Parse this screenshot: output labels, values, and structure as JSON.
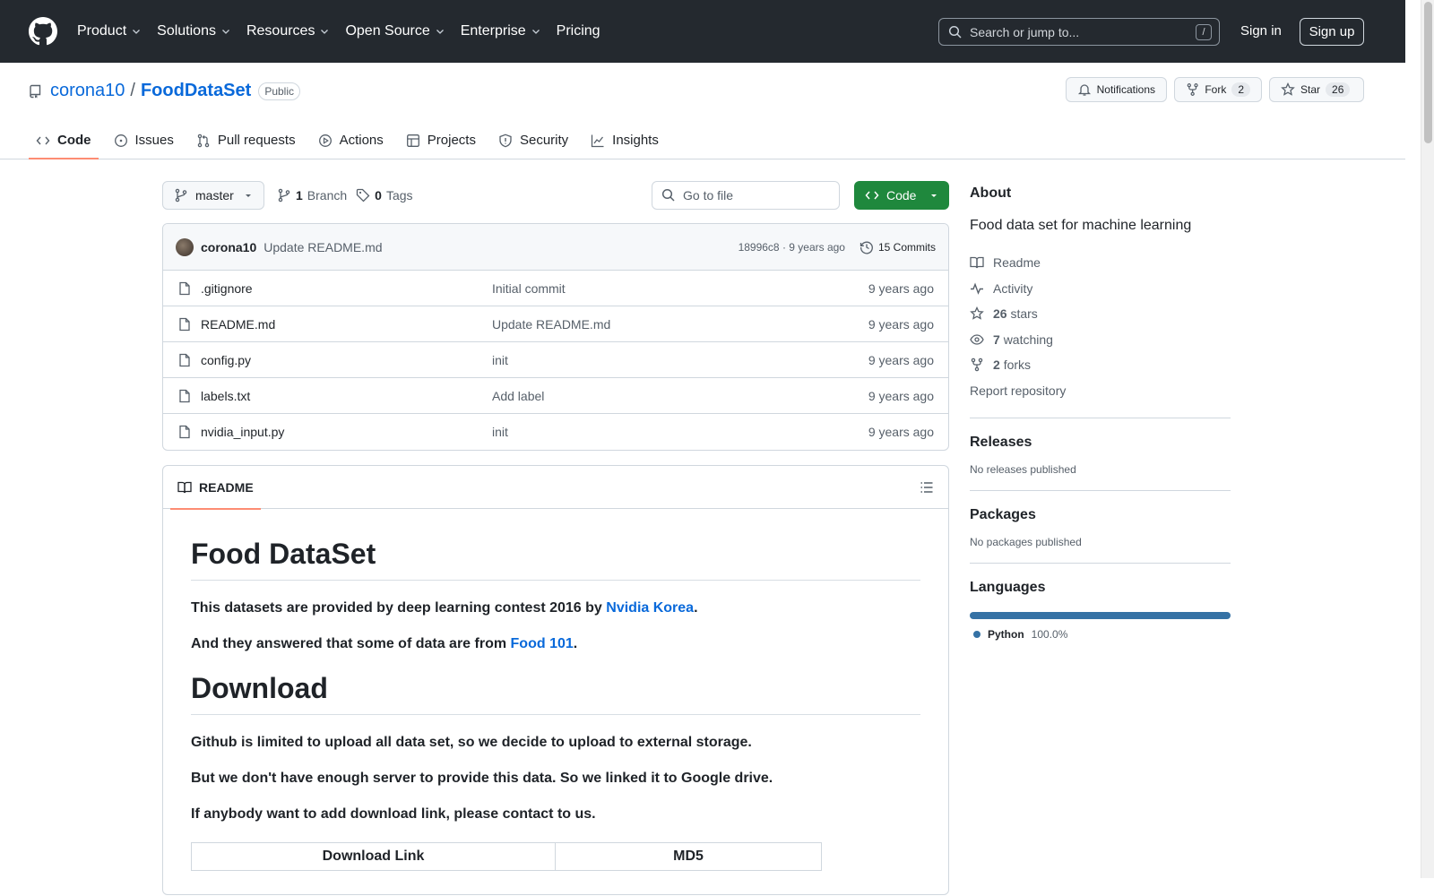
{
  "header": {
    "nav": [
      "Product",
      "Solutions",
      "Resources",
      "Open Source",
      "Enterprise",
      "Pricing"
    ],
    "search_placeholder": "Search or jump to...",
    "search_key": "/",
    "signin": "Sign in",
    "signup": "Sign up"
  },
  "repo": {
    "owner": "corona10",
    "separator": "/",
    "name": "FoodDataSet",
    "visibility": "Public",
    "notifications": "Notifications",
    "fork_label": "Fork",
    "fork_count": "2",
    "star_label": "Star",
    "star_count": "26"
  },
  "tabs": [
    "Code",
    "Issues",
    "Pull requests",
    "Actions",
    "Projects",
    "Security",
    "Insights"
  ],
  "filebar": {
    "branch": "master",
    "branch_count": "1",
    "branch_label": "Branch",
    "tag_count": "0",
    "tag_label": "Tags",
    "goto_placeholder": "Go to file",
    "code_button": "Code"
  },
  "last_commit": {
    "author": "corona10",
    "message": "Update README.md",
    "meta": "18996c8 · 9 years ago",
    "commits": "15 Commits"
  },
  "files": [
    {
      "name": ".gitignore",
      "message": "Initial commit",
      "age": "9 years ago"
    },
    {
      "name": "README.md",
      "message": "Update README.md",
      "age": "9 years ago"
    },
    {
      "name": "config.py",
      "message": "init",
      "age": "9 years ago"
    },
    {
      "name": "labels.txt",
      "message": "Add label",
      "age": "9 years ago"
    },
    {
      "name": "nvidia_input.py",
      "message": "init",
      "age": "9 years ago"
    }
  ],
  "readme": {
    "tab": "README",
    "h1": "Food DataSet",
    "p1_text": "This datasets are provided by deep learning contest 2016 by ",
    "p1_link": "Nvidia Korea",
    "p1_end": ".",
    "p2_text": "And they answered that some of data are from ",
    "p2_link": "Food 101",
    "p2_end": ".",
    "h2": "Download",
    "p3": "Github is limited to upload all data set, so we decide to upload to external storage.",
    "p4": "But we don't have enough server to provide this data. So we linked it to Google drive.",
    "p5": "If anybody want to add download link, please contact to us.",
    "table_headers": [
      "Download Link",
      "MD5"
    ]
  },
  "sidebar": {
    "about_title": "About",
    "description": "Food data set for machine learning",
    "readme": "Readme",
    "activity": "Activity",
    "stars_count": "26",
    "stars_label": "stars",
    "watching_count": "7",
    "watching_label": "watching",
    "forks_count": "2",
    "forks_label": "forks",
    "report": "Report repository",
    "releases_title": "Releases",
    "releases_text": "No releases published",
    "packages_title": "Packages",
    "packages_text": "No packages published",
    "languages_title": "Languages",
    "language_name": "Python",
    "language_pct": "100.0%",
    "language_color": "#3572a5"
  }
}
